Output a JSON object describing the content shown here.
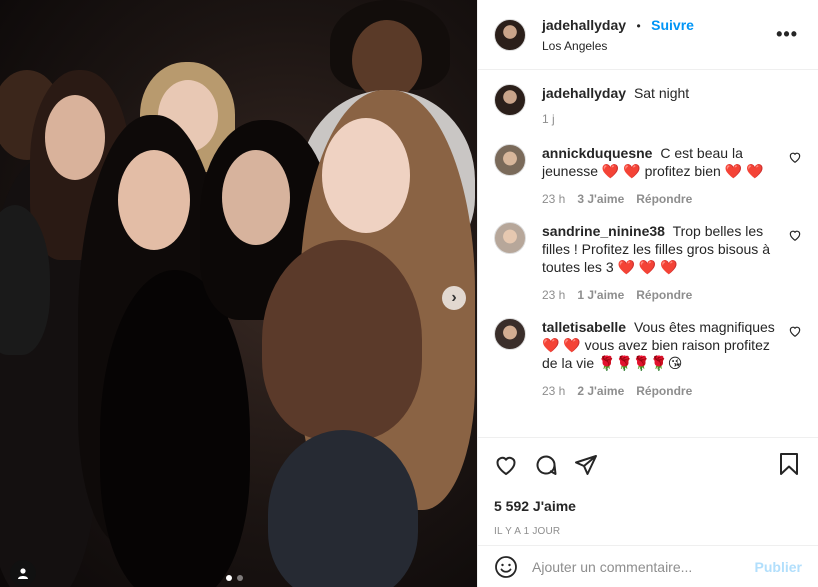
{
  "post": {
    "username": "jadehallyday",
    "follow_label": "Suivre",
    "separator": "•",
    "location": "Los Angeles",
    "more_label": "•••"
  },
  "caption": {
    "username": "jadehallyday",
    "text": "Sat night",
    "time": "1 j"
  },
  "comments": [
    {
      "username": "annickduquesne",
      "text": "C est beau la jeunesse ❤️ ❤️ profitez bien ❤️ ❤️",
      "time": "23 h",
      "likes": "3 J'aime",
      "reply": "Répondre"
    },
    {
      "username": "sandrine_ninine38",
      "text": "Trop belles les filles ! Profitez les filles gros bisous à toutes les 3 ❤️ ❤️ ❤️",
      "time": "23 h",
      "likes": "1 J'aime",
      "reply": "Répondre"
    },
    {
      "username": "talletisabelle",
      "text": "Vous êtes magnifiques ❤️ ❤️ vous avez bien raison profitez de la vie 🌹🌹🌹🌹😘",
      "time": "23 h",
      "likes": "2 J'aime",
      "reply": "Répondre"
    }
  ],
  "likes_count": "5 592 J'aime",
  "date": "IL Y A 1 JOUR",
  "add_comment": {
    "placeholder": "Ajouter un commentaire...",
    "publish_label": "Publier"
  },
  "icons": {
    "like": "heart-icon",
    "comment": "comment-icon",
    "share": "share-icon",
    "save": "bookmark-icon",
    "emoji": "emoji-icon",
    "next": "chevron-right-icon",
    "tag": "user-tag-icon"
  },
  "colors": {
    "link_blue": "#0095f6",
    "publish_disabled": "#b2dffc",
    "muted": "#8e8e8e",
    "heart": "#e0245e"
  },
  "carousel": {
    "slide_count": 2,
    "active_index": 0
  }
}
